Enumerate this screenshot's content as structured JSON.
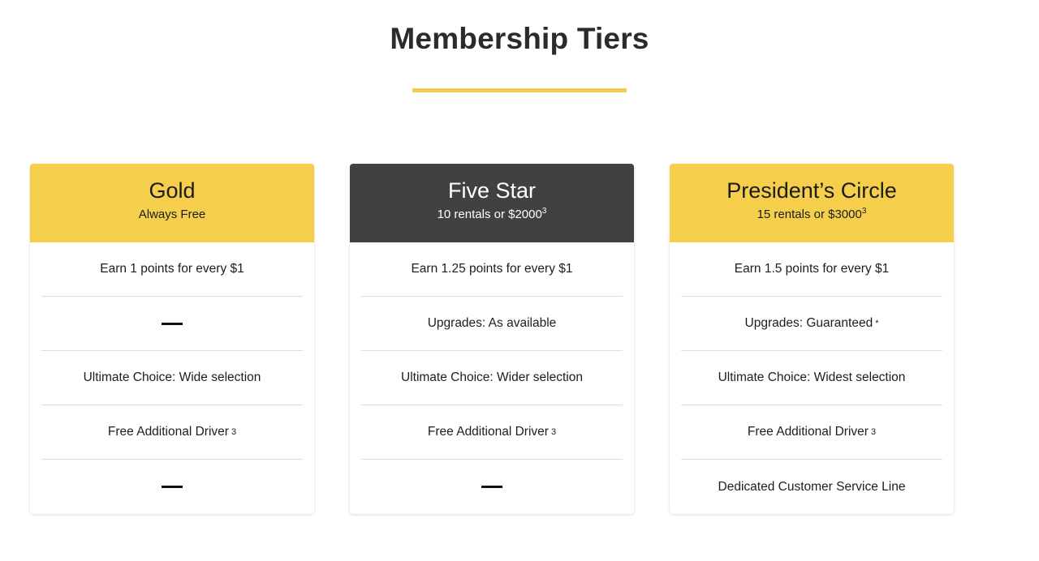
{
  "header": {
    "title": "Membership Tiers",
    "accent_color": "#f2cd4f"
  },
  "colors": {
    "gold": "#f5ce4b",
    "dark": "#414042",
    "text_dark": "#1d1d1d",
    "divider": "#dcdcdc"
  },
  "tiers": [
    {
      "name": "Gold",
      "subtitle": "Always Free",
      "subtitle_sup": "",
      "theme": "gold",
      "features": [
        {
          "text": "Earn 1 points for every $1",
          "sup": "",
          "empty": false
        },
        {
          "text": "",
          "sup": "",
          "empty": true
        },
        {
          "text": "Ultimate Choice: Wide selection",
          "sup": "",
          "empty": false
        },
        {
          "text": "Free Additional Driver",
          "sup": "3",
          "empty": false
        },
        {
          "text": "",
          "sup": "",
          "empty": true
        }
      ]
    },
    {
      "name": "Five Star",
      "subtitle": "10 rentals or $2000",
      "subtitle_sup": "3",
      "theme": "dark",
      "features": [
        {
          "text": "Earn 1.25 points for every $1",
          "sup": "",
          "empty": false
        },
        {
          "text": "Upgrades: As available",
          "sup": "",
          "empty": false
        },
        {
          "text": "Ultimate Choice: Wider selection",
          "sup": "",
          "empty": false
        },
        {
          "text": "Free Additional Driver",
          "sup": "3",
          "empty": false
        },
        {
          "text": "",
          "sup": "",
          "empty": true
        }
      ]
    },
    {
      "name": "President’s Circle",
      "subtitle": "15 rentals or $3000",
      "subtitle_sup": "3",
      "theme": "gold",
      "features": [
        {
          "text": "Earn 1.5 points for every $1",
          "sup": "",
          "empty": false
        },
        {
          "text": "Upgrades: Guaranteed",
          "sup": "*",
          "empty": false
        },
        {
          "text": "Ultimate Choice: Widest selection",
          "sup": "",
          "empty": false
        },
        {
          "text": "Free Additional Driver",
          "sup": "3",
          "empty": false
        },
        {
          "text": "Dedicated Customer Service Line",
          "sup": "",
          "empty": false
        }
      ]
    }
  ]
}
